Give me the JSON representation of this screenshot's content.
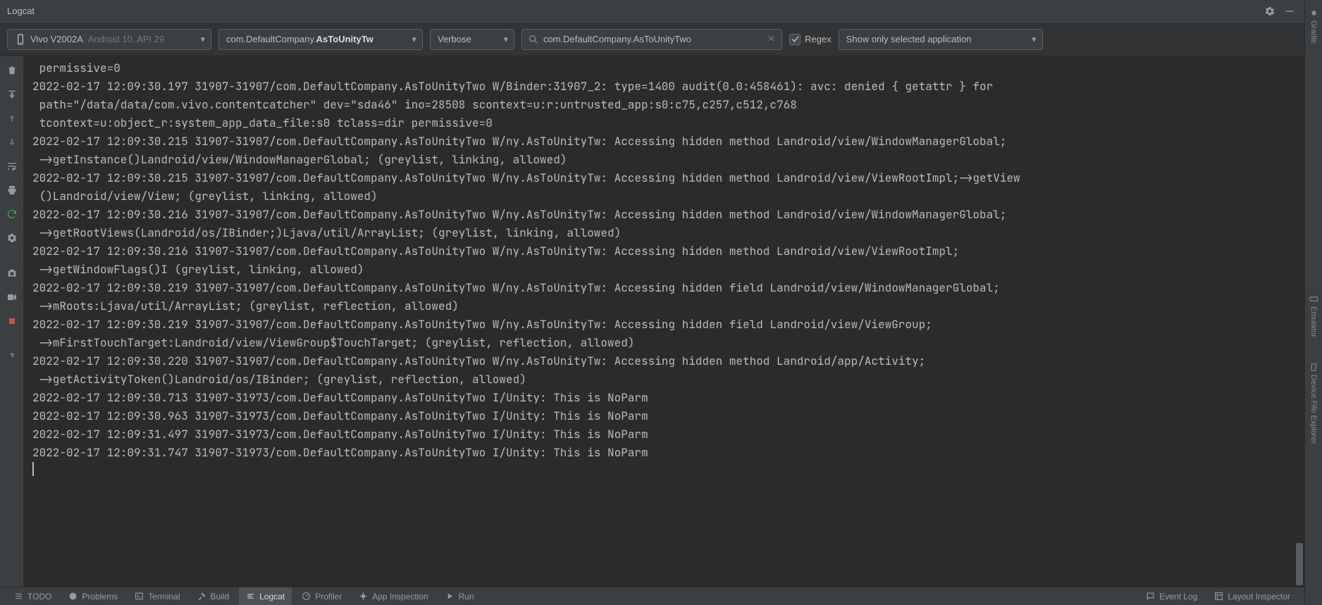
{
  "titlebar": {
    "title": "Logcat"
  },
  "toolbar": {
    "device": {
      "name": "Vivo V2002A",
      "info": "Android 10, API 29"
    },
    "package": {
      "prefix": "com.DefaultCompany.",
      "bold": "AsToUnityTw"
    },
    "level": "Verbose",
    "search_value": "com.DefaultCompany.AsToUnityTwo",
    "regex_label": "Regex",
    "scope": "Show only selected application"
  },
  "log_lines": [
    " permissive=0",
    "2022-02-17 12:09:30.197 31907-31907/com.DefaultCompany.AsToUnityTwo W/Binder:31907_2: type=1400 audit(0.0:458461): avc: denied { getattr } for",
    " path=\"/data/data/com.vivo.contentcatcher\" dev=\"sda46\" ino=28508 scontext=u:r:untrusted_app:s0:c75,c257,c512,c768",
    " tcontext=u:object_r:system_app_data_file:s0 tclass=dir permissive=0",
    "2022-02-17 12:09:30.215 31907-31907/com.DefaultCompany.AsToUnityTwo W/ny.AsToUnityTw: Accessing hidden method Landroid/view/WindowManagerGlobal;",
    " ->getInstance()Landroid/view/WindowManagerGlobal; (greylist, linking, allowed)",
    "2022-02-17 12:09:30.215 31907-31907/com.DefaultCompany.AsToUnityTwo W/ny.AsToUnityTw: Accessing hidden method Landroid/view/ViewRootImpl;->getView",
    " ()Landroid/view/View; (greylist, linking, allowed)",
    "2022-02-17 12:09:30.216 31907-31907/com.DefaultCompany.AsToUnityTwo W/ny.AsToUnityTw: Accessing hidden method Landroid/view/WindowManagerGlobal;",
    " ->getRootViews(Landroid/os/IBinder;)Ljava/util/ArrayList; (greylist, linking, allowed)",
    "2022-02-17 12:09:30.216 31907-31907/com.DefaultCompany.AsToUnityTwo W/ny.AsToUnityTw: Accessing hidden method Landroid/view/ViewRootImpl;",
    " ->getWindowFlags()I (greylist, linking, allowed)",
    "2022-02-17 12:09:30.219 31907-31907/com.DefaultCompany.AsToUnityTwo W/ny.AsToUnityTw: Accessing hidden field Landroid/view/WindowManagerGlobal;",
    " ->mRoots:Ljava/util/ArrayList; (greylist, reflection, allowed)",
    "2022-02-17 12:09:30.219 31907-31907/com.DefaultCompany.AsToUnityTwo W/ny.AsToUnityTw: Accessing hidden field Landroid/view/ViewGroup;",
    " ->mFirstTouchTarget:Landroid/view/ViewGroup$TouchTarget; (greylist, reflection, allowed)",
    "2022-02-17 12:09:30.220 31907-31907/com.DefaultCompany.AsToUnityTwo W/ny.AsToUnityTw: Accessing hidden method Landroid/app/Activity;",
    " ->getActivityToken()Landroid/os/IBinder; (greylist, reflection, allowed)",
    "2022-02-17 12:09:30.713 31907-31973/com.DefaultCompany.AsToUnityTwo I/Unity: This is NoParm",
    "2022-02-17 12:09:30.963 31907-31973/com.DefaultCompany.AsToUnityTwo I/Unity: This is NoParm",
    "2022-02-17 12:09:31.497 31907-31973/com.DefaultCompany.AsToUnityTwo I/Unity: This is NoParm",
    "2022-02-17 12:09:31.747 31907-31973/com.DefaultCompany.AsToUnityTwo I/Unity: This is NoParm"
  ],
  "bottom_tabs": {
    "todo": "TODO",
    "problems": "Problems",
    "terminal": "Terminal",
    "build": "Build",
    "logcat": "Logcat",
    "profiler": "Profiler",
    "app_inspection": "App Inspection",
    "run": "Run",
    "event_log": "Event Log",
    "layout_inspector": "Layout Inspector"
  },
  "right_tabs": {
    "gradle": "Gradle",
    "emulator": "Emulator",
    "device_explorer": "Device File Explorer"
  }
}
